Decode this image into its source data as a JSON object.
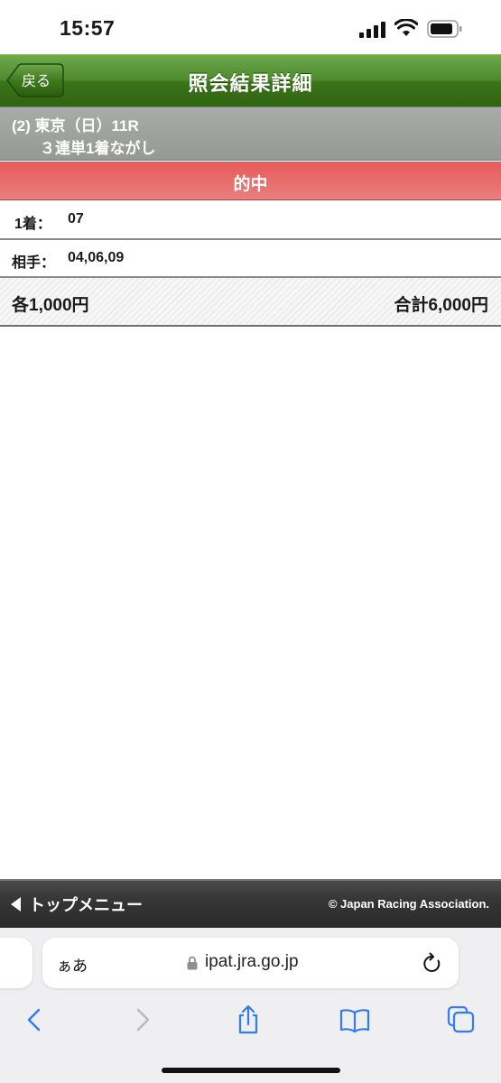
{
  "status_bar": {
    "time": "15:57"
  },
  "header": {
    "back_label": "戻る",
    "title": "照会結果詳細"
  },
  "race_info": {
    "line1": "(2) 東京（日）11R",
    "line2": "３連単1着ながし"
  },
  "result_banner": {
    "text": "的中"
  },
  "bet_detail": {
    "first_label": "1着：",
    "first_value": "07",
    "partner_label": "相手：",
    "partner_value": "04,06,09",
    "unit_amount": "各1,000円",
    "total_amount": "合計6,000円"
  },
  "footer": {
    "top_menu_label": "トップメニュー",
    "copyright": "© Japan Racing Association."
  },
  "browser": {
    "aa_label": "ぁあ",
    "url": "ipat.jra.go.jp"
  },
  "colors": {
    "header_green": "#3b7419",
    "banner_red": "#e85a5a",
    "race_info_gray": "#979996",
    "footer_dark": "#2a2a2a",
    "ios_blue": "#2f7cf6"
  },
  "icons": [
    "signal-icon",
    "wifi-icon",
    "battery-icon",
    "lock-icon",
    "reload-icon",
    "back-arrow-icon",
    "forward-arrow-icon",
    "share-icon",
    "bookmarks-icon",
    "tabs-icon"
  ]
}
